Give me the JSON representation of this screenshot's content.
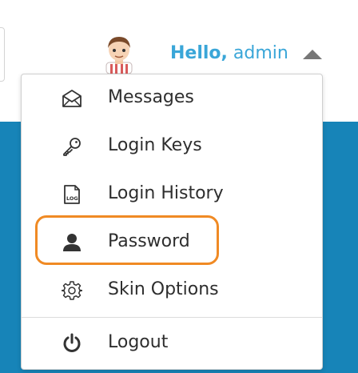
{
  "header": {
    "greeting": "Hello,",
    "username": "admin",
    "avatar_icon": "user-avatar-icon",
    "toggle_icon": "caret-up-icon"
  },
  "menu": {
    "items": [
      {
        "label": "Messages",
        "icon": "envelope-icon"
      },
      {
        "label": "Login Keys",
        "icon": "key-icon"
      },
      {
        "label": "Login History",
        "icon": "log-file-icon"
      },
      {
        "label": "Password",
        "icon": "user-icon"
      },
      {
        "label": "Skin Options",
        "icon": "gear-icon"
      },
      {
        "label": "Logout",
        "icon": "power-icon"
      }
    ],
    "highlighted_item": "Password"
  },
  "colors": {
    "accent": "#3aa6d8",
    "highlight": "#f08a24",
    "background_band": "#1784b8",
    "menu_text": "#2e2e2e"
  }
}
